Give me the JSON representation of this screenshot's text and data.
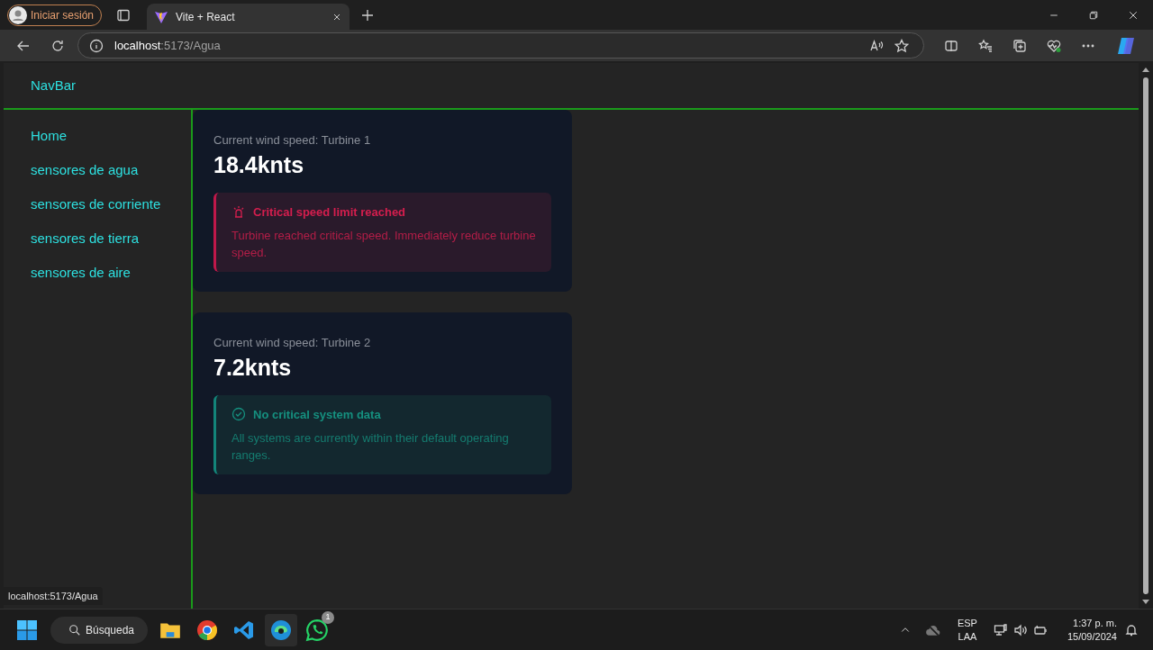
{
  "browser": {
    "profile_button": "Iniciar sesión",
    "tab": {
      "title": "Vite + React",
      "selected": true
    },
    "address": {
      "host": "localhost",
      "path": ":5173/Agua"
    }
  },
  "navbar": {
    "title": "NavBar"
  },
  "sidebar": {
    "items": [
      {
        "label": "Home"
      },
      {
        "label": "sensores de agua"
      },
      {
        "label": "sensores de corriente"
      },
      {
        "label": "sensores de tierra"
      },
      {
        "label": "sensores de aire"
      }
    ]
  },
  "cards": [
    {
      "label": "Current wind speed: Turbine 1",
      "value": "18.4knts",
      "alert": {
        "kind": "critical",
        "title": "Critical speed limit reached",
        "message": "Turbine reached critical speed. Immediately reduce turbine speed."
      }
    },
    {
      "label": "Current wind speed: Turbine 2",
      "value": "7.2knts",
      "alert": {
        "kind": "ok",
        "title": "No critical system data",
        "message": "All systems are currently within their default operating ranges."
      }
    }
  ],
  "status_url": "localhost:5173/Agua",
  "taskbar": {
    "search": "Búsqueda",
    "badge": "1",
    "language": "ESP",
    "layout": "LAA",
    "time": "1:37 p. m.",
    "date": "15/09/2024"
  }
}
